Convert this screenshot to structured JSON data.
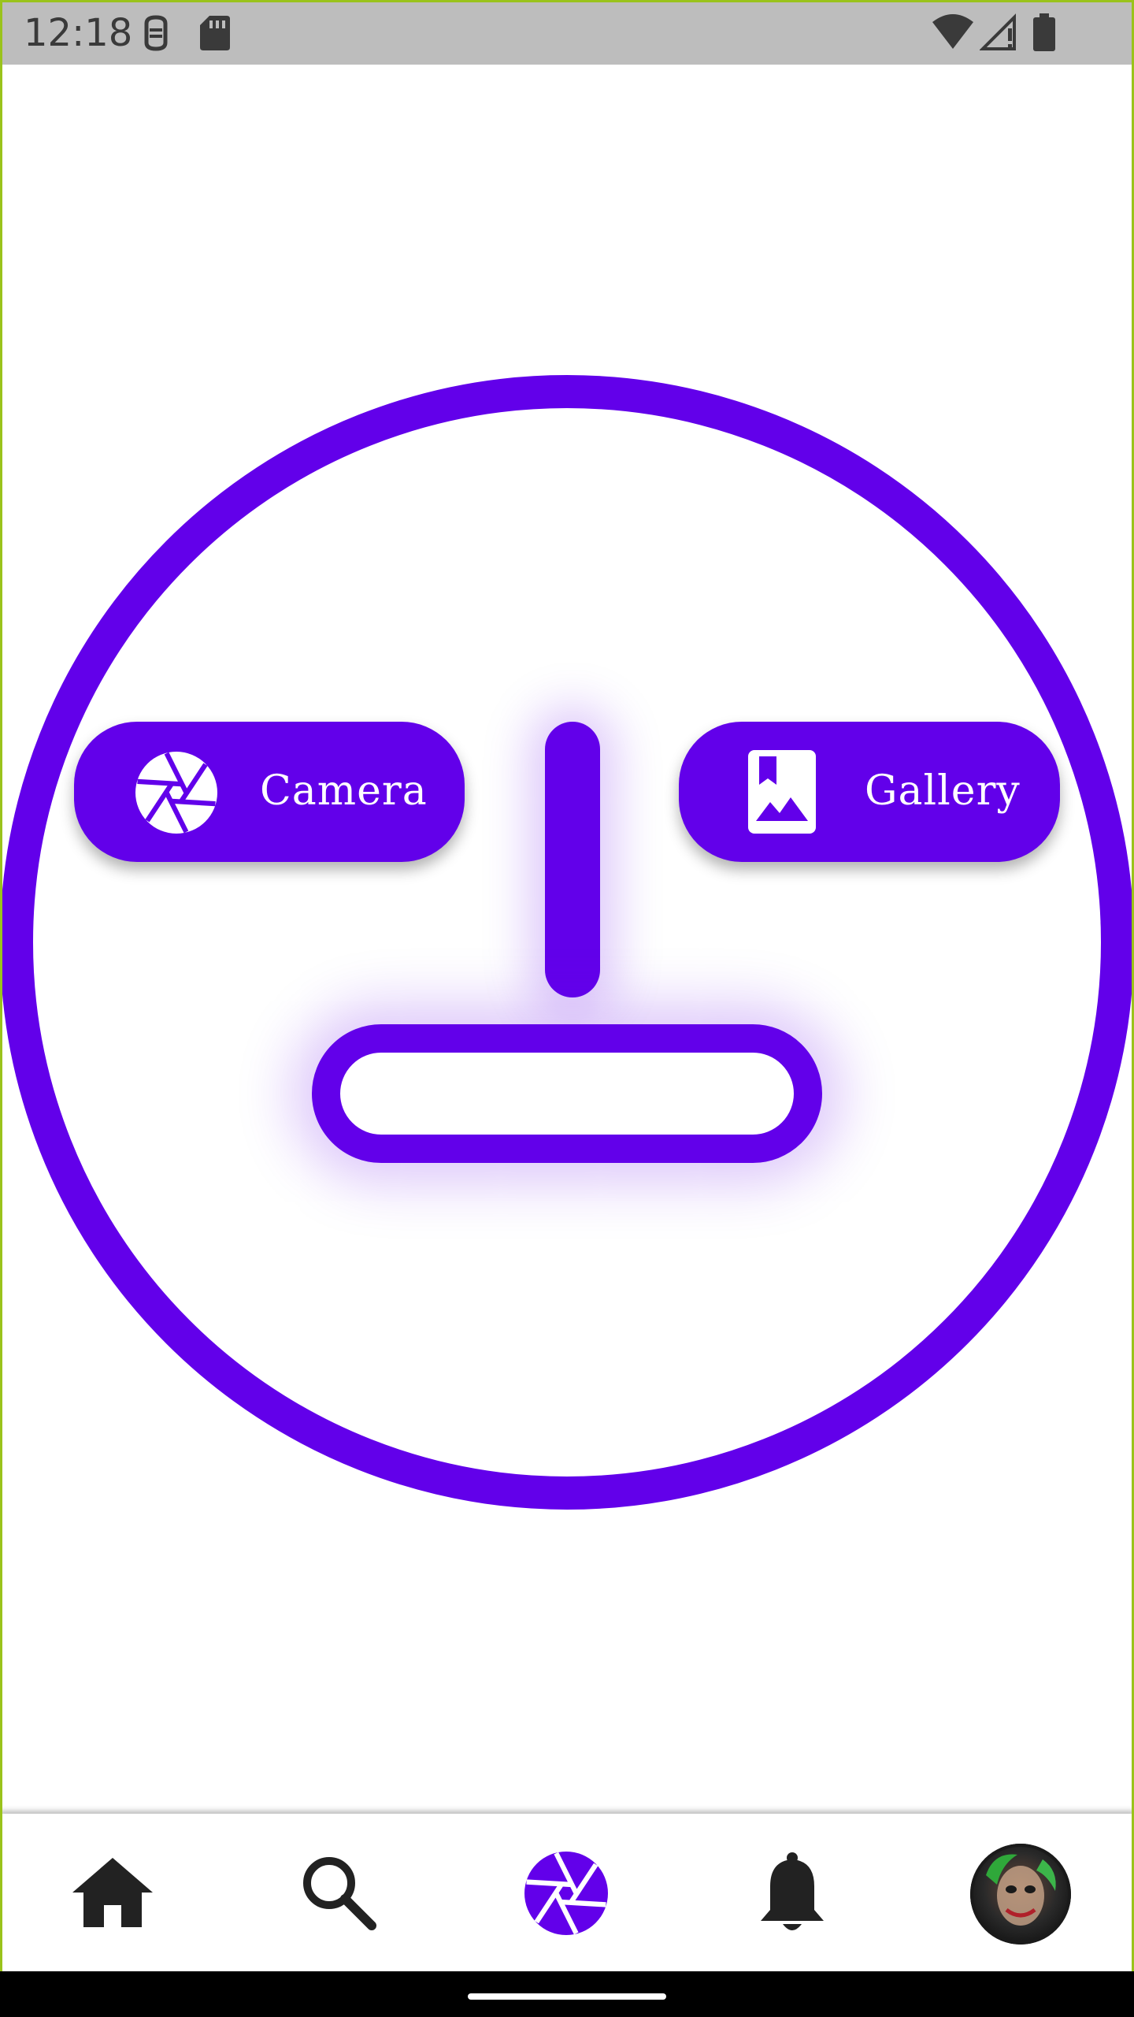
{
  "status_bar": {
    "time": "12:18",
    "icons": [
      "notification-badge-icon",
      "sd-card-icon",
      "wifi-icon",
      "signal-icon",
      "battery-icon"
    ]
  },
  "main": {
    "camera_button": {
      "label": "Camera",
      "icon": "camera-aperture-icon"
    },
    "gallery_button": {
      "label": "Gallery",
      "icon": "photo-album-icon"
    }
  },
  "bottom_nav": {
    "items": [
      {
        "icon": "home-icon"
      },
      {
        "icon": "search-icon"
      },
      {
        "icon": "camera-aperture-icon",
        "active": true
      },
      {
        "icon": "bell-icon"
      },
      {
        "icon": "avatar"
      }
    ]
  },
  "colors": {
    "accent": "#6200ea",
    "status_bar": "#bdbdbd",
    "nav_icon": "#222222"
  }
}
